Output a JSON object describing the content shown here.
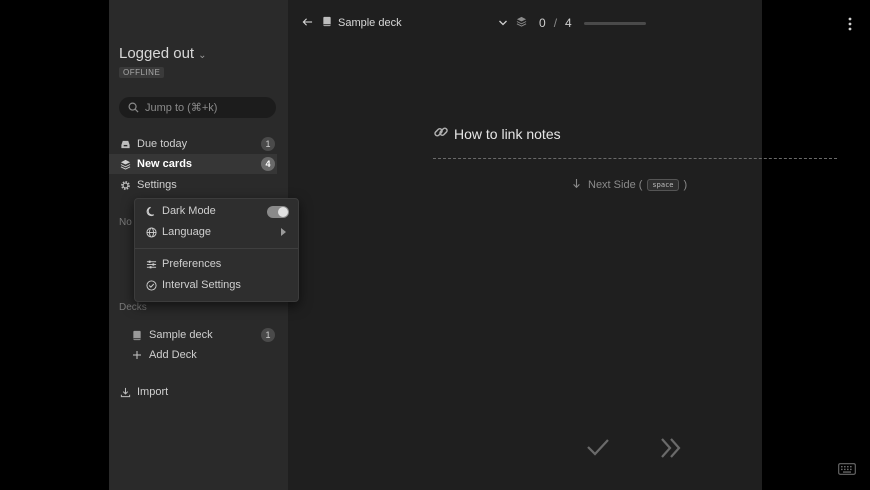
{
  "sidebar": {
    "user_status": "Logged out",
    "connection_badge": "OFFLINE",
    "search_placeholder": "Jump to (⌘+k)",
    "nav": [
      {
        "label": "Due today",
        "count": "1"
      },
      {
        "label": "New cards",
        "count": "4"
      },
      {
        "label": "Settings"
      }
    ],
    "partial_section": "No",
    "decks_label": "Decks",
    "decks": [
      {
        "label": "Sample deck",
        "count": "1"
      }
    ],
    "add_deck": "Add Deck",
    "import": "Import"
  },
  "settings_menu": {
    "items": [
      "Dark Mode",
      "Language",
      "Preferences",
      "Interval Settings"
    ],
    "dark_mode_on": true
  },
  "topbar": {
    "deck_title": "Sample deck",
    "current": "0",
    "separator": "/",
    "total": "4",
    "progress_fraction": 0
  },
  "card": {
    "title": "How to link notes",
    "next_side_label": "Next Side (",
    "next_side_key": "space",
    "next_side_close": ")"
  },
  "colors": {
    "sidebar_bg": "#2a2a2a",
    "main_bg": "#1f1f1f",
    "accent_text": "#e6e6e6"
  }
}
